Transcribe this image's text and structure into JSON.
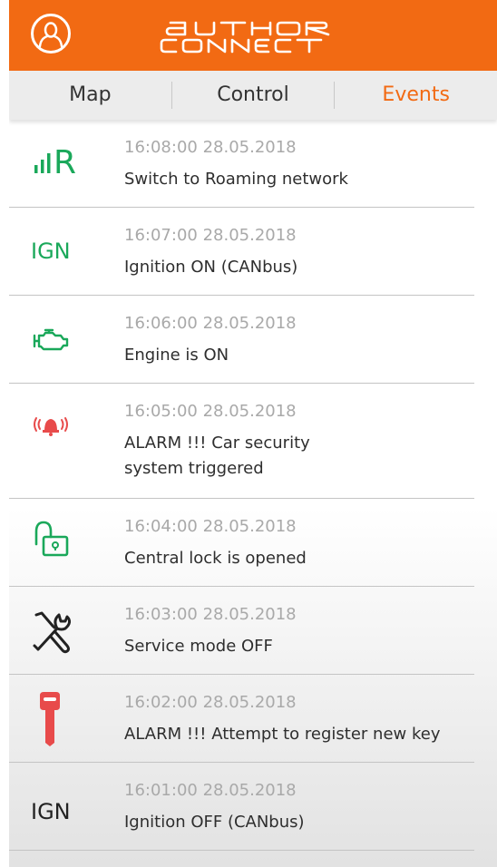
{
  "header": {
    "logo_line1": "AUTHOR",
    "logo_line2": "CONNECT",
    "accent": "#f26a13"
  },
  "tabs": [
    {
      "label": "Map",
      "active": false
    },
    {
      "label": "Control",
      "active": false
    },
    {
      "label": "Events",
      "active": true
    }
  ],
  "events": [
    {
      "icon": "roaming-signal-icon",
      "icon_text": "R",
      "color": "#1aa85a",
      "time": "16:08:00 28.05.2018",
      "desc_lines": [
        "Switch to Roaming network"
      ]
    },
    {
      "icon": "ignition-on-icon",
      "icon_text": "IGN",
      "color": "#1aa85a",
      "time": "16:07:00 28.05.2018",
      "desc_lines": [
        "Ignition ON (CANbus)"
      ]
    },
    {
      "icon": "engine-icon",
      "icon_text": "",
      "color": "#1aa85a",
      "time": "16:06:00 28.05.2018",
      "desc_lines": [
        "Engine is ON"
      ]
    },
    {
      "icon": "alarm-bell-icon",
      "icon_text": "",
      "color": "#e84b4b",
      "time": "16:05:00 28.05.2018",
      "desc_lines": [
        "ALARM !!! Car security",
        "system triggered"
      ]
    },
    {
      "icon": "unlocked-padlock-icon",
      "icon_text": "",
      "color": "#1aa85a",
      "time": "16:04:00 28.05.2018",
      "desc_lines": [
        "Central lock is opened"
      ]
    },
    {
      "icon": "wrench-screwdriver-icon",
      "icon_text": "",
      "color": "#222222",
      "time": "16:03:00 28.05.2018",
      "desc_lines": [
        "Service mode OFF"
      ]
    },
    {
      "icon": "key-icon",
      "icon_text": "",
      "color": "#e84b4b",
      "time": "16:02:00 28.05.2018",
      "desc_lines": [
        "ALARM !!! Attempt to register new key"
      ]
    },
    {
      "icon": "ignition-off-icon",
      "icon_text": "IGN",
      "color": "#222222",
      "time": "16:01:00 28.05.2018",
      "desc_lines": [
        "Ignition OFF (CANbus)"
      ]
    }
  ]
}
